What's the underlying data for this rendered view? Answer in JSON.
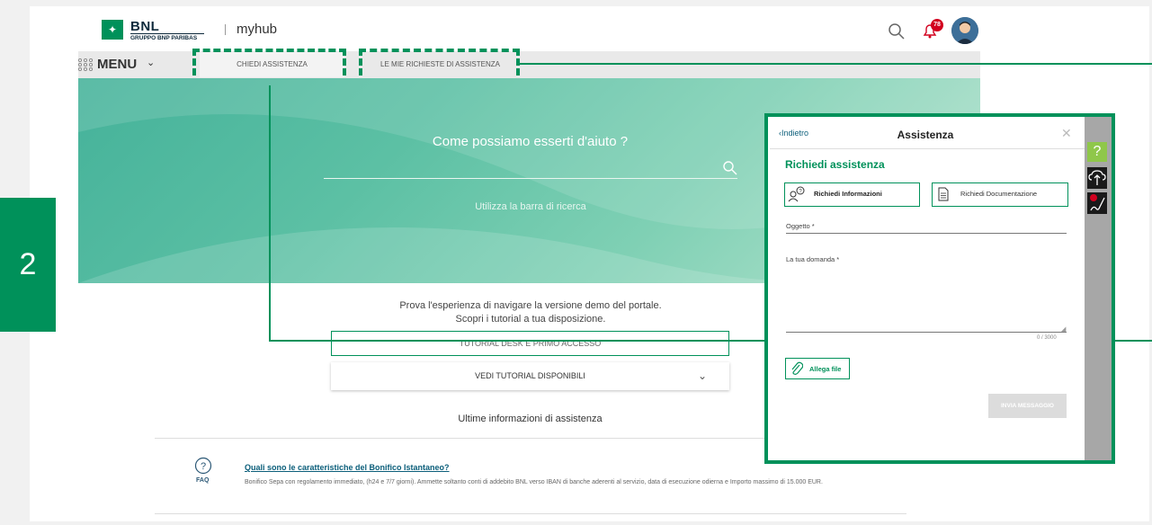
{
  "header": {
    "brand": "BNL",
    "brand_sub": "GRUPPO BNP PARIBAS",
    "app_name": "myhub",
    "notification_count": "78",
    "icons": [
      "search-icon",
      "bell-icon",
      "avatar"
    ]
  },
  "nav": {
    "menu_label": "MENU",
    "items": [
      {
        "label": "CHIEDI ASSISTENZA"
      },
      {
        "label": "LE MIE RICHIESTE DI ASSISTENZA"
      }
    ]
  },
  "hero": {
    "title": "Come possiamo esserti d'aiuto ?",
    "subtitle": "Utilizza la barra di ricerca"
  },
  "demo": {
    "line1": "Prova l'esperienza di navigare la versione demo del portale.",
    "line2": "Scopri i tutorial a tua disposizione.",
    "tutorial_button": "TUTORIAL DESK E PRIMO ACCESSO",
    "tutorial_dropdown": "VEDI TUTORIAL DISPONIBILI"
  },
  "latest": {
    "title": "Ultime informazioni di assistenza",
    "faq_label": "FAQ",
    "faq_title": "Quali sono le caratteristiche del Bonifico Istantaneo?",
    "faq_desc": "Bonifico Sepa con regolamento immediato, (h24 e 7/7 giorni). Ammette soltanto conti di addebito BNL verso IBAN di banche aderenti al servizio, data di esecuzione odierna e Importo massimo di 15.000 EUR."
  },
  "step": {
    "number": "2"
  },
  "panel": {
    "back": "Indietro",
    "title": "Assistenza",
    "heading": "Richiedi assistenza",
    "option1": "Richiedi Informazioni",
    "option2": "Richiedi Documentazione",
    "field_subject": "Oggetto *",
    "field_question": "La tua domanda *",
    "counter": "0 / 3000",
    "attach": "Allega file",
    "send": "INVIA MESSAGGIO",
    "side_help": "?"
  },
  "colors": {
    "accent": "#00915a",
    "link": "#0b5e7a"
  }
}
